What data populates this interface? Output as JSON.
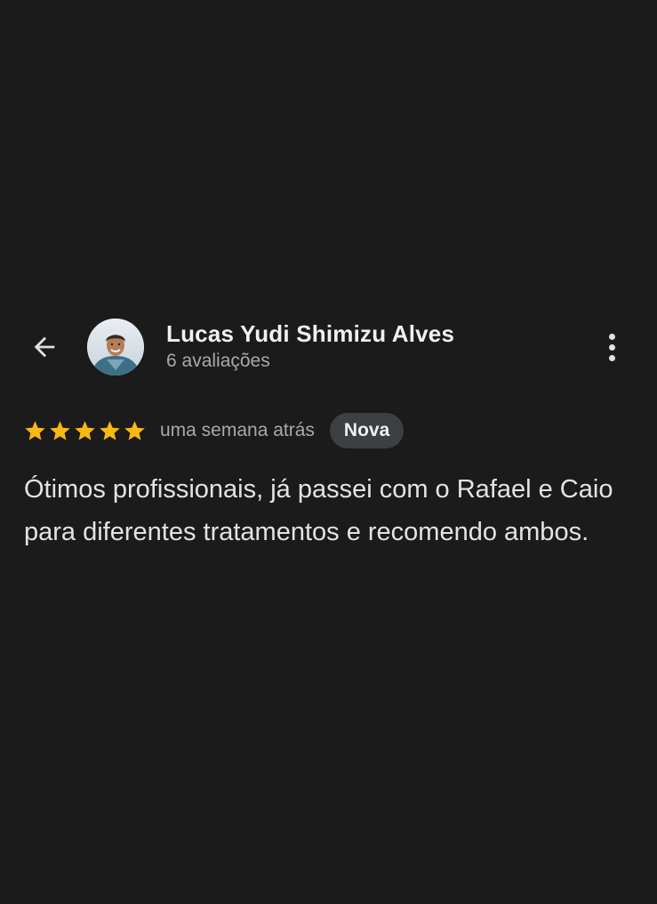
{
  "reviewer": {
    "name": "Lucas Yudi Shimizu Alves",
    "review_count": "6 avaliações"
  },
  "review": {
    "rating": 5,
    "max_rating": 5,
    "time_ago": "uma semana atrás",
    "badge": "Nova",
    "text": "Ótimos profissionais, já passei com o Rafael e Caio para diferentes tratamentos e recomendo ambos."
  },
  "icons": {
    "back": "arrow-left-icon",
    "more": "more-vert-icon",
    "star": "star-icon"
  },
  "colors": {
    "background": "#1b1b1b",
    "star": "#f9b813",
    "badge_bg": "#3c3f44",
    "secondary_text": "#a9a9a9"
  }
}
